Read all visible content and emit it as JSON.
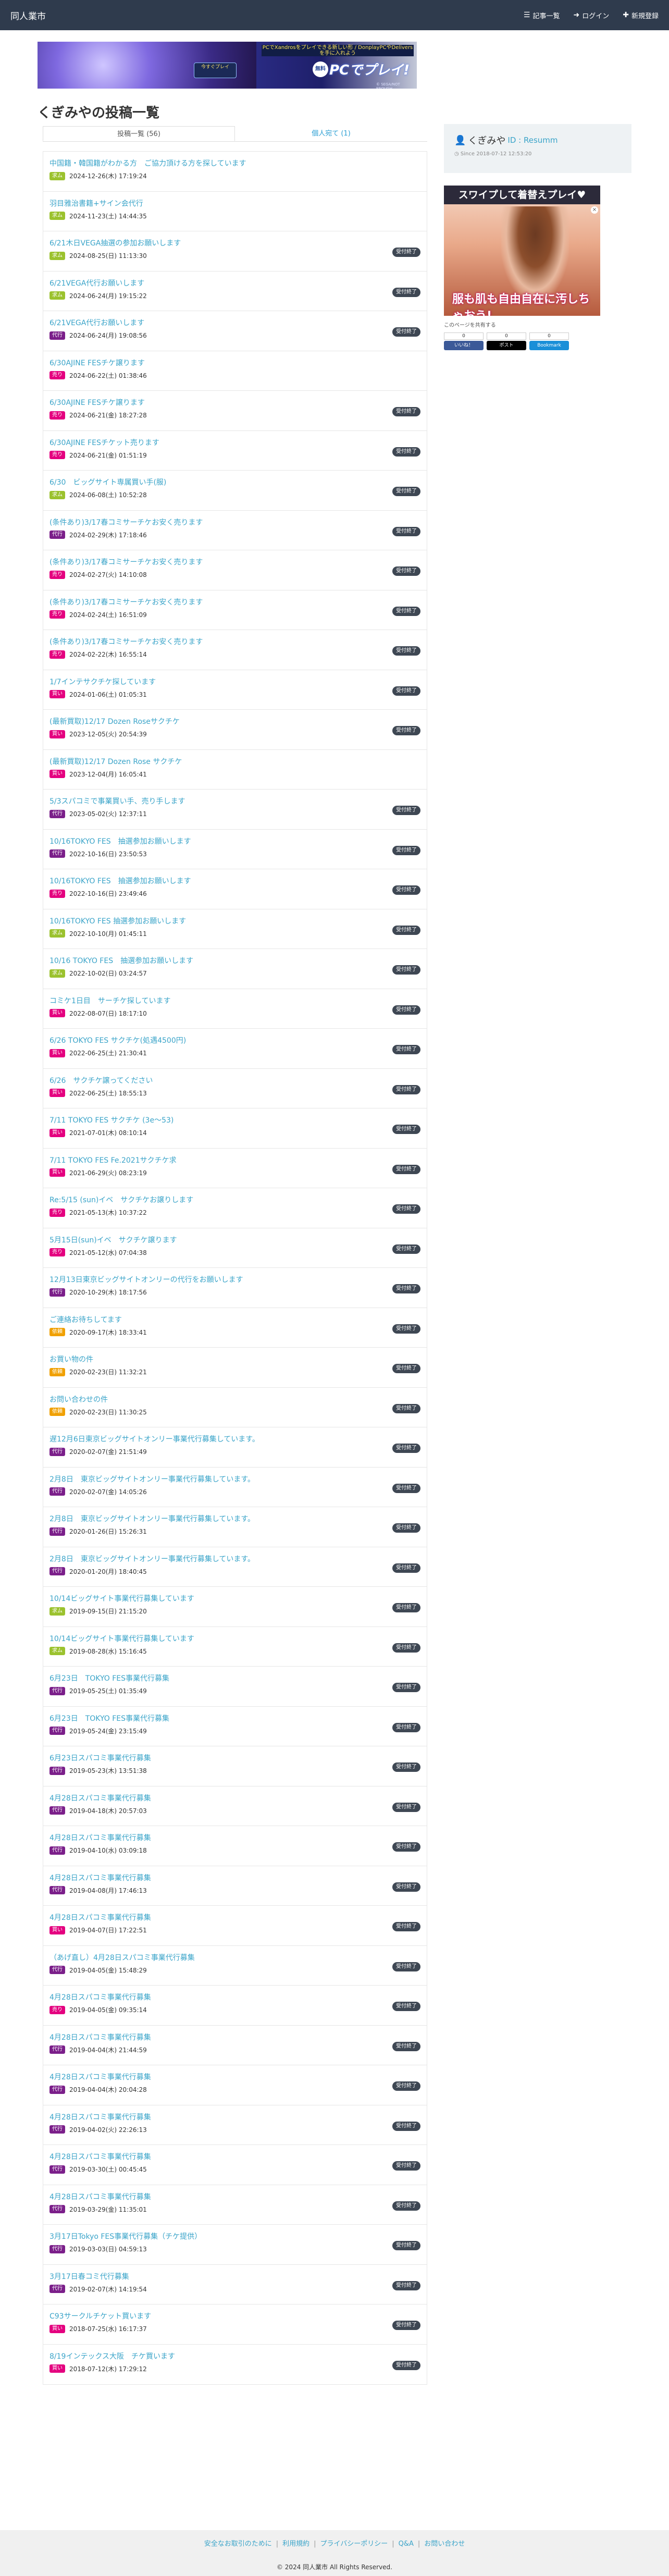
{
  "colors": {
    "navbar_bg": "#2f3b4d",
    "link": "#3aa4c9",
    "closed_badge": "#3e4753",
    "tag_buy": "#9bc22e",
    "tag_sell": "#e4007f",
    "tag_trade": "#17a2b8",
    "tag_proxy": "#7b1f8a",
    "tag_request": "#f0a000"
  },
  "navbar": {
    "brand": "同人業市",
    "links": [
      {
        "label": "記事一覧",
        "icon": "list-icon"
      },
      {
        "label": "ログイン",
        "icon": "login-icon"
      },
      {
        "label": "新規登録",
        "icon": "plus-icon"
      }
    ]
  },
  "banner": {
    "top_text": "PCでXandrosをプレイできる新しい形 / DonplayPCやDeliversを手に入れよう",
    "button_text": "今すぐプレイ",
    "circle_text": "無料",
    "main_text": "PCでプレイ!",
    "copyright": "© SEGA/NOT ENOUGH"
  },
  "page": {
    "title": "くぎみやの投稿一覧"
  },
  "tabs": [
    {
      "label": "投稿一覧 (56)",
      "active": true
    },
    {
      "label": "個人宛て (1)",
      "active": false
    }
  ],
  "posts": [
    {
      "title": "中国籍・韓国籍がわかる方　ご協力頂ける方を探しています",
      "tag": "求ム",
      "date": "2024-12-26(木) 17:19:24",
      "closed": ""
    },
    {
      "title": "羽目雅治書籍+サイン会代行",
      "tag": "求ム",
      "date": "2024-11-23(土) 14:44:35",
      "closed": ""
    },
    {
      "title": "6/21木日VEGA抽選の参加お願いします",
      "tag": "求ム",
      "date": "2024-08-25(日) 11:13:30",
      "closed": "受付終了"
    },
    {
      "title": "6/21VEGA代行お願いします",
      "tag": "求ム",
      "date": "2024-06-24(月) 19:15:22",
      "closed": "受付終了"
    },
    {
      "title": "6/21VEGA代行お願いします",
      "tag": "代行",
      "date": "2024-06-24(月) 19:08:56",
      "closed": "受付終了"
    },
    {
      "title": "6/30AJINE FESチケ譲ります",
      "tag": "売り",
      "date": "2024-06-22(土) 01:38:46",
      "closed": ""
    },
    {
      "title": "6/30AJINE FESチケ譲ります",
      "tag": "売り",
      "date": "2024-06-21(金) 18:27:28",
      "closed": "受付終了"
    },
    {
      "title": "6/30AJINE FESチケット売ります",
      "tag": "売り",
      "date": "2024-06-21(金) 01:51:19",
      "closed": "受付終了"
    },
    {
      "title": "6/30　ビッグサイト専属買い手(服)",
      "tag": "求ム",
      "date": "2024-06-08(土) 10:52:28",
      "closed": "受付終了"
    },
    {
      "title": "(条件あり)3/17春コミサーチケお安く売ります",
      "tag": "代行",
      "date": "2024-02-29(木) 17:18:46",
      "closed": "受付終了"
    },
    {
      "title": "(条件あり)3/17春コミサーチケお安く売ります",
      "tag": "売り",
      "date": "2024-02-27(火) 14:10:08",
      "closed": "受付終了"
    },
    {
      "title": "(条件あり)3/17春コミサーチケお安く売ります",
      "tag": "売り",
      "date": "2024-02-24(土) 16:51:09",
      "closed": "受付終了"
    },
    {
      "title": "(条件あり)3/17春コミサーチケお安く売ります",
      "tag": "売り",
      "date": "2024-02-22(木) 16:55:14",
      "closed": "受付終了"
    },
    {
      "title": "1/7インテサクチケ探しています",
      "tag": "買い",
      "date": "2024-01-06(土) 01:05:31",
      "closed": "受付終了"
    },
    {
      "title": "(最新買取)12/17 Dozen Roseサクチケ",
      "tag": "買い",
      "date": "2023-12-05(火) 20:54:39",
      "closed": "受付終了"
    },
    {
      "title": "(最新買取)12/17 Dozen Rose サクチケ",
      "tag": "買い",
      "date": "2023-12-04(月) 16:05:41",
      "closed": ""
    },
    {
      "title": "5/3スパコミで事業買い手、売り手します",
      "tag": "代行",
      "date": "2023-05-02(火) 12:37:11",
      "closed": "受付終了"
    },
    {
      "title": "10/16TOKYO FES　抽選参加お願いします",
      "tag": "代行",
      "date": "2022-10-16(日) 23:50:53",
      "closed": "受付終了"
    },
    {
      "title": "10/16TOKYO FES　抽選参加お願いします",
      "tag": "売り",
      "date": "2022-10-16(日) 23:49:46",
      "closed": "受付終了"
    },
    {
      "title": "10/16TOKYO FES 抽選参加お願いします",
      "tag": "求ム",
      "date": "2022-10-10(月) 01:45:11",
      "closed": "受付終了"
    },
    {
      "title": "10/16 TOKYO FES　抽選参加お願いします",
      "tag": "求ム",
      "date": "2022-10-02(日) 03:24:57",
      "closed": "受付終了"
    },
    {
      "title": "コミケ1日目　サーチケ探しています",
      "tag": "買い",
      "date": "2022-08-07(日) 18:17:10",
      "closed": "受付終了"
    },
    {
      "title": "6/26 TOKYO FES サクチケ(処遇4500円)",
      "tag": "買い",
      "date": "2022-06-25(土) 21:30:41",
      "closed": "受付終了"
    },
    {
      "title": "6/26　サクチケ譲ってください",
      "tag": "買い",
      "date": "2022-06-25(土) 18:55:13",
      "closed": "受付終了"
    },
    {
      "title": "7/11 TOKYO FES サクチケ (3e〜53)",
      "tag": "買い",
      "date": "2021-07-01(木) 08:10:14",
      "closed": "受付終了"
    },
    {
      "title": "7/11 TOKYO FES Fe.2021サクチケ求",
      "tag": "買い",
      "date": "2021-06-29(火) 08:23:19",
      "closed": "受付終了"
    },
    {
      "title": "Re:5/15 (sun)イベ　サクチケお譲りします",
      "tag": "売り",
      "date": "2021-05-13(木) 10:37:22",
      "closed": "受付終了"
    },
    {
      "title": "5月15日(sun)イベ　サクチケ譲ります",
      "tag": "売り",
      "date": "2021-05-12(水) 07:04:38",
      "closed": "受付終了"
    },
    {
      "title": "12月13日東京ビッグサイトオンリーの代行をお願いします",
      "tag": "代行",
      "date": "2020-10-29(木) 18:17:56",
      "closed": "受付終了"
    },
    {
      "title": "ご連絡お待ちしてます",
      "tag": "依頼",
      "date": "2020-09-17(木) 18:33:41",
      "closed": "受付終了"
    },
    {
      "title": "お買い物の件",
      "tag": "依頼",
      "date": "2020-02-23(日) 11:32:21",
      "closed": "受付終了"
    },
    {
      "title": "お問い合わせの件",
      "tag": "依頼",
      "date": "2020-02-23(日) 11:30:25",
      "closed": "受付終了"
    },
    {
      "title": "遅12月6日東京ビッグサイトオンリー事業代行募集しています。",
      "tag": "代行",
      "date": "2020-02-07(金) 21:51:49",
      "closed": "受付終了"
    },
    {
      "title": "2月8日　東京ビッグサイトオンリー事業代行募集しています。",
      "tag": "代行",
      "date": "2020-02-07(金) 14:05:26",
      "closed": "受付終了"
    },
    {
      "title": "2月8日　東京ビッグサイトオンリー事業代行募集しています。",
      "tag": "代行",
      "date": "2020-01-26(日) 15:26:31",
      "closed": "受付終了"
    },
    {
      "title": "2月8日　東京ビッグサイトオンリー事業代行募集しています。",
      "tag": "代行",
      "date": "2020-01-20(月) 18:40:45",
      "closed": "受付終了"
    },
    {
      "title": "10/14ビッグサイト事業代行募集しています",
      "tag": "求ム",
      "date": "2019-09-15(日) 21:15:20",
      "closed": "受付終了"
    },
    {
      "title": "10/14ビッグサイト事業代行募集しています",
      "tag": "求ム",
      "date": "2019-08-28(水) 15:16:45",
      "closed": "受付終了"
    },
    {
      "title": "6月23日　TOKYO FES事業代行募集",
      "tag": "代行",
      "date": "2019-05-25(土) 01:35:49",
      "closed": "受付終了"
    },
    {
      "title": "6月23日　TOKYO FES事業代行募集",
      "tag": "代行",
      "date": "2019-05-24(金) 23:15:49",
      "closed": "受付終了"
    },
    {
      "title": "6月23日スパコミ事業代行募集",
      "tag": "代行",
      "date": "2019-05-23(木) 13:51:38",
      "closed": "受付終了"
    },
    {
      "title": "4月28日スパコミ事業代行募集",
      "tag": "代行",
      "date": "2019-04-18(木) 20:57:03",
      "closed": "受付終了"
    },
    {
      "title": "4月28日スパコミ事業代行募集",
      "tag": "代行",
      "date": "2019-04-10(水) 03:09:18",
      "closed": "受付終了"
    },
    {
      "title": "4月28日スパコミ事業代行募集",
      "tag": "代行",
      "date": "2019-04-08(月) 17:46:13",
      "closed": "受付終了"
    },
    {
      "title": "4月28日スパコミ事業代行募集",
      "tag": "買い",
      "date": "2019-04-07(日) 17:22:51",
      "closed": "受付終了"
    },
    {
      "title": "（あげ直し）4月28日スパコミ事業代行募集",
      "tag": "代行",
      "date": "2019-04-05(金) 15:48:29",
      "closed": "受付終了"
    },
    {
      "title": "4月28日スパコミ事業代行募集",
      "tag": "売り",
      "date": "2019-04-05(金) 09:35:14",
      "closed": "受付終了"
    },
    {
      "title": "4月28日スパコミ事業代行募集",
      "tag": "代行",
      "date": "2019-04-04(木) 21:44:59",
      "closed": "受付終了"
    },
    {
      "title": "4月28日スパコミ事業代行募集",
      "tag": "代行",
      "date": "2019-04-04(木) 20:04:28",
      "closed": "受付終了"
    },
    {
      "title": "4月28日スパコミ事業代行募集",
      "tag": "代行",
      "date": "2019-04-02(火) 22:26:13",
      "closed": "受付終了"
    },
    {
      "title": "4月28日スパコミ事業代行募集",
      "tag": "代行",
      "date": "2019-03-30(土) 00:45:45",
      "closed": "受付終了"
    },
    {
      "title": "4月28日スパコミ事業代行募集",
      "tag": "代行",
      "date": "2019-03-29(金) 11:35:01",
      "closed": "受付終了"
    },
    {
      "title": "3月17日Tokyo FES事業代行募集（チケ提供）",
      "tag": "代行",
      "date": "2019-03-03(日) 04:59:13",
      "closed": "受付終了"
    },
    {
      "title": "3月17日春コミ代行募集",
      "tag": "代行",
      "date": "2019-02-07(木) 14:19:54",
      "closed": "受付終了"
    },
    {
      "title": "C93サークルチケット買います",
      "tag": "買い",
      "date": "2018-07-25(水) 16:17:37",
      "closed": "受付終了"
    },
    {
      "title": "8/19インテックス大阪　チケ買います",
      "tag": "買い",
      "date": "2018-07-12(木) 17:29:12",
      "closed": "受付終了"
    }
  ],
  "profile": {
    "name": "くぎみや",
    "id_label": "ID : Resumm",
    "since": "Since 2018-07-12 12:53:20"
  },
  "ad2": {
    "top_text": "スワイプして着替えプレイ♥",
    "bottom_text": "服も肌も自由自在に汚しちゃおう!",
    "close": "×"
  },
  "share": {
    "label": "このページを共有する",
    "buttons": [
      {
        "label": "いいね！",
        "count": "0",
        "color": "#3b5998"
      },
      {
        "label": "ポスト",
        "count": "0",
        "color": "#000000"
      },
      {
        "label": "Bookmark",
        "count": "0",
        "color": "#1a8fd8"
      }
    ]
  },
  "footer": {
    "links": [
      "安全なお取引のために",
      "利用規約",
      "プライバシーポリシー",
      "Q&A",
      "お問い合わせ"
    ],
    "copyright": "© 2024 同人業市 All Rights Reserved."
  }
}
